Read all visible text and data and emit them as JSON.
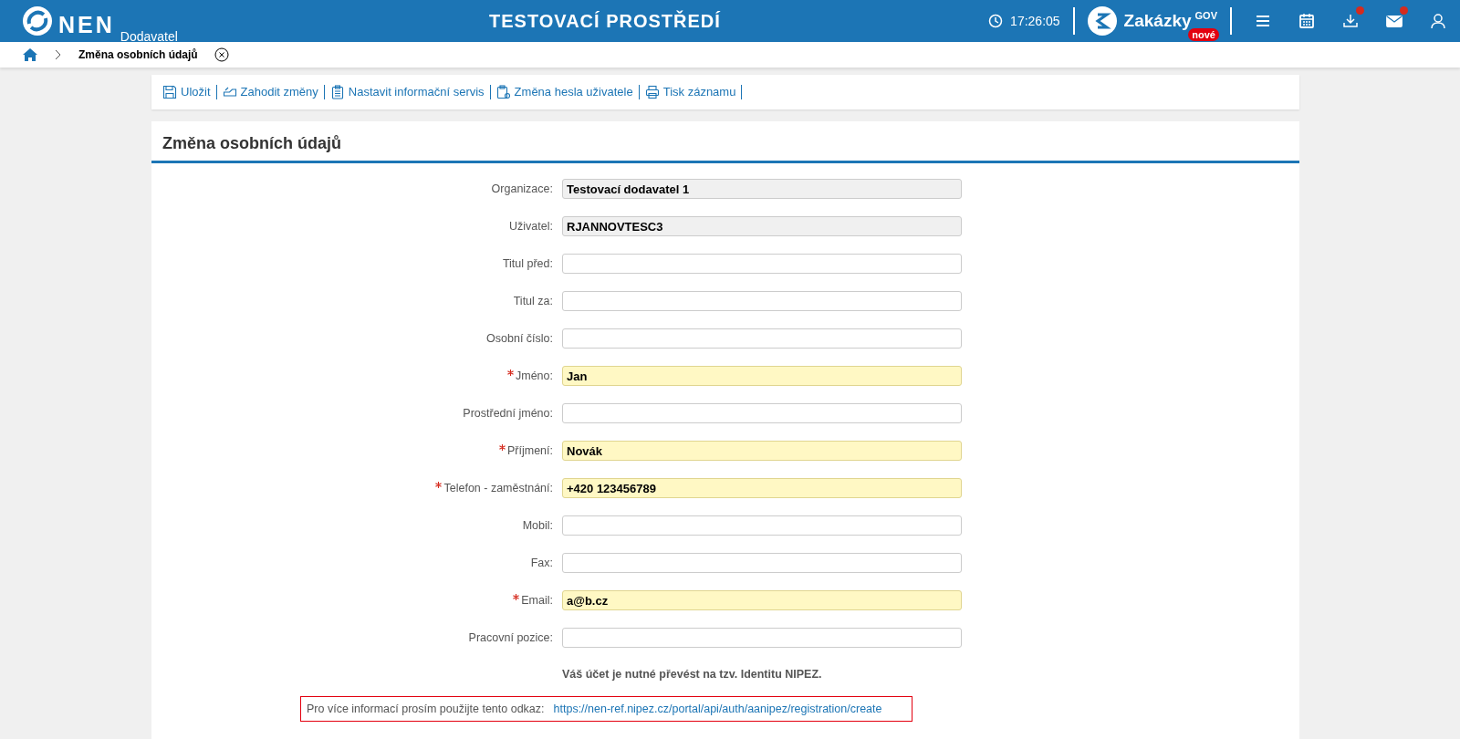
{
  "header": {
    "logo": "NEN",
    "logo_sub": "Dodavatel",
    "env_title": "TESTOVACÍ PROSTŘEDÍ",
    "time": "17:26:05",
    "brand": "Zakázky",
    "brand_sup": "GOV",
    "brand_badge": "nové",
    "icons": [
      {
        "kind": "menu",
        "notification": false
      },
      {
        "kind": "calendar",
        "notification": false
      },
      {
        "kind": "download",
        "notification": true
      },
      {
        "kind": "mail",
        "notification": true
      },
      {
        "kind": "user",
        "notification": false
      }
    ]
  },
  "breadcrumb": {
    "current": "Změna osobních údajů"
  },
  "toolbar": [
    {
      "kind": "save",
      "label": "Uložit"
    },
    {
      "kind": "discard",
      "label": "Zahodit změny"
    },
    {
      "kind": "clipboard",
      "label": "Nastavit informační servis"
    },
    {
      "kind": "password",
      "label": "Změna hesla uživatele"
    },
    {
      "kind": "print",
      "label": "Tisk záznamu"
    }
  ],
  "form": {
    "title": "Změna osobních údajů",
    "fields": [
      {
        "label": "Organizace:",
        "value": "Testovací dodavatel 1",
        "required": false,
        "readonly": true
      },
      {
        "label": "Uživatel:",
        "value": "RJANNOVTESC3",
        "required": false,
        "readonly": true
      },
      {
        "label": "Titul před:",
        "required": false,
        "readonly": false
      },
      {
        "label": "Titul za:",
        "required": false,
        "readonly": false
      },
      {
        "label": "Osobní číslo:",
        "required": false,
        "readonly": false
      },
      {
        "label": "Jméno:",
        "value": "Jan",
        "required": true,
        "readonly": false
      },
      {
        "label": "Prostřední jméno:",
        "required": false,
        "readonly": false
      },
      {
        "label": "Příjmení:",
        "value": "Novák",
        "required": true,
        "readonly": false
      },
      {
        "label": "Telefon - zaměstnání:",
        "value": "+420 123456789",
        "required": true,
        "readonly": false
      },
      {
        "label": "Mobil:",
        "required": false,
        "readonly": false
      },
      {
        "label": "Fax:",
        "required": false,
        "readonly": false
      },
      {
        "label": "Email:",
        "value": "a@b.cz",
        "required": true,
        "readonly": false
      },
      {
        "label": "Pracovní pozice:",
        "required": false,
        "readonly": false
      }
    ],
    "notice": "Váš účet je nutné převést na tzv. Identitu NIPEZ.",
    "link_label": "Pro více informací prosím použijte tento odkaz:",
    "link": "https://nen-ref.nipez.cz/portal/api/auth/aanipez/registration/create"
  }
}
